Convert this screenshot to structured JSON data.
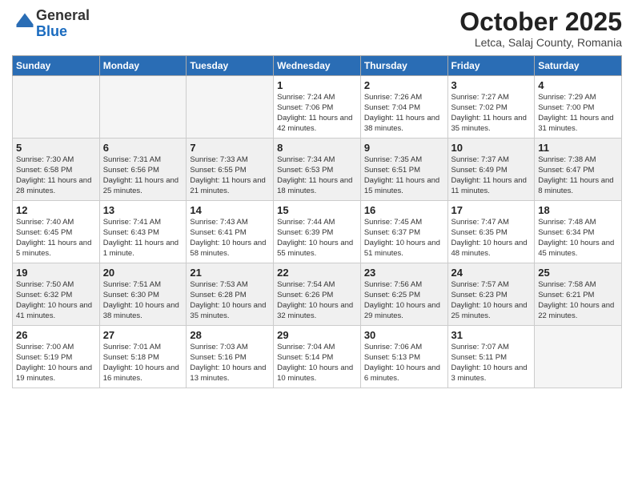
{
  "logo": {
    "general": "General",
    "blue": "Blue"
  },
  "header": {
    "month": "October 2025",
    "location": "Letca, Salaj County, Romania"
  },
  "weekdays": [
    "Sunday",
    "Monday",
    "Tuesday",
    "Wednesday",
    "Thursday",
    "Friday",
    "Saturday"
  ],
  "weeks": [
    [
      {
        "day": "",
        "detail": ""
      },
      {
        "day": "",
        "detail": ""
      },
      {
        "day": "",
        "detail": ""
      },
      {
        "day": "1",
        "detail": "Sunrise: 7:24 AM\nSunset: 7:06 PM\nDaylight: 11 hours\nand 42 minutes."
      },
      {
        "day": "2",
        "detail": "Sunrise: 7:26 AM\nSunset: 7:04 PM\nDaylight: 11 hours\nand 38 minutes."
      },
      {
        "day": "3",
        "detail": "Sunrise: 7:27 AM\nSunset: 7:02 PM\nDaylight: 11 hours\nand 35 minutes."
      },
      {
        "day": "4",
        "detail": "Sunrise: 7:29 AM\nSunset: 7:00 PM\nDaylight: 11 hours\nand 31 minutes."
      }
    ],
    [
      {
        "day": "5",
        "detail": "Sunrise: 7:30 AM\nSunset: 6:58 PM\nDaylight: 11 hours\nand 28 minutes."
      },
      {
        "day": "6",
        "detail": "Sunrise: 7:31 AM\nSunset: 6:56 PM\nDaylight: 11 hours\nand 25 minutes."
      },
      {
        "day": "7",
        "detail": "Sunrise: 7:33 AM\nSunset: 6:55 PM\nDaylight: 11 hours\nand 21 minutes."
      },
      {
        "day": "8",
        "detail": "Sunrise: 7:34 AM\nSunset: 6:53 PM\nDaylight: 11 hours\nand 18 minutes."
      },
      {
        "day": "9",
        "detail": "Sunrise: 7:35 AM\nSunset: 6:51 PM\nDaylight: 11 hours\nand 15 minutes."
      },
      {
        "day": "10",
        "detail": "Sunrise: 7:37 AM\nSunset: 6:49 PM\nDaylight: 11 hours\nand 11 minutes."
      },
      {
        "day": "11",
        "detail": "Sunrise: 7:38 AM\nSunset: 6:47 PM\nDaylight: 11 hours\nand 8 minutes."
      }
    ],
    [
      {
        "day": "12",
        "detail": "Sunrise: 7:40 AM\nSunset: 6:45 PM\nDaylight: 11 hours\nand 5 minutes."
      },
      {
        "day": "13",
        "detail": "Sunrise: 7:41 AM\nSunset: 6:43 PM\nDaylight: 11 hours\nand 1 minute."
      },
      {
        "day": "14",
        "detail": "Sunrise: 7:43 AM\nSunset: 6:41 PM\nDaylight: 10 hours\nand 58 minutes."
      },
      {
        "day": "15",
        "detail": "Sunrise: 7:44 AM\nSunset: 6:39 PM\nDaylight: 10 hours\nand 55 minutes."
      },
      {
        "day": "16",
        "detail": "Sunrise: 7:45 AM\nSunset: 6:37 PM\nDaylight: 10 hours\nand 51 minutes."
      },
      {
        "day": "17",
        "detail": "Sunrise: 7:47 AM\nSunset: 6:35 PM\nDaylight: 10 hours\nand 48 minutes."
      },
      {
        "day": "18",
        "detail": "Sunrise: 7:48 AM\nSunset: 6:34 PM\nDaylight: 10 hours\nand 45 minutes."
      }
    ],
    [
      {
        "day": "19",
        "detail": "Sunrise: 7:50 AM\nSunset: 6:32 PM\nDaylight: 10 hours\nand 41 minutes."
      },
      {
        "day": "20",
        "detail": "Sunrise: 7:51 AM\nSunset: 6:30 PM\nDaylight: 10 hours\nand 38 minutes."
      },
      {
        "day": "21",
        "detail": "Sunrise: 7:53 AM\nSunset: 6:28 PM\nDaylight: 10 hours\nand 35 minutes."
      },
      {
        "day": "22",
        "detail": "Sunrise: 7:54 AM\nSunset: 6:26 PM\nDaylight: 10 hours\nand 32 minutes."
      },
      {
        "day": "23",
        "detail": "Sunrise: 7:56 AM\nSunset: 6:25 PM\nDaylight: 10 hours\nand 29 minutes."
      },
      {
        "day": "24",
        "detail": "Sunrise: 7:57 AM\nSunset: 6:23 PM\nDaylight: 10 hours\nand 25 minutes."
      },
      {
        "day": "25",
        "detail": "Sunrise: 7:58 AM\nSunset: 6:21 PM\nDaylight: 10 hours\nand 22 minutes."
      }
    ],
    [
      {
        "day": "26",
        "detail": "Sunrise: 7:00 AM\nSunset: 5:19 PM\nDaylight: 10 hours\nand 19 minutes."
      },
      {
        "day": "27",
        "detail": "Sunrise: 7:01 AM\nSunset: 5:18 PM\nDaylight: 10 hours\nand 16 minutes."
      },
      {
        "day": "28",
        "detail": "Sunrise: 7:03 AM\nSunset: 5:16 PM\nDaylight: 10 hours\nand 13 minutes."
      },
      {
        "day": "29",
        "detail": "Sunrise: 7:04 AM\nSunset: 5:14 PM\nDaylight: 10 hours\nand 10 minutes."
      },
      {
        "day": "30",
        "detail": "Sunrise: 7:06 AM\nSunset: 5:13 PM\nDaylight: 10 hours\nand 6 minutes."
      },
      {
        "day": "31",
        "detail": "Sunrise: 7:07 AM\nSunset: 5:11 PM\nDaylight: 10 hours\nand 3 minutes."
      },
      {
        "day": "",
        "detail": ""
      }
    ]
  ]
}
